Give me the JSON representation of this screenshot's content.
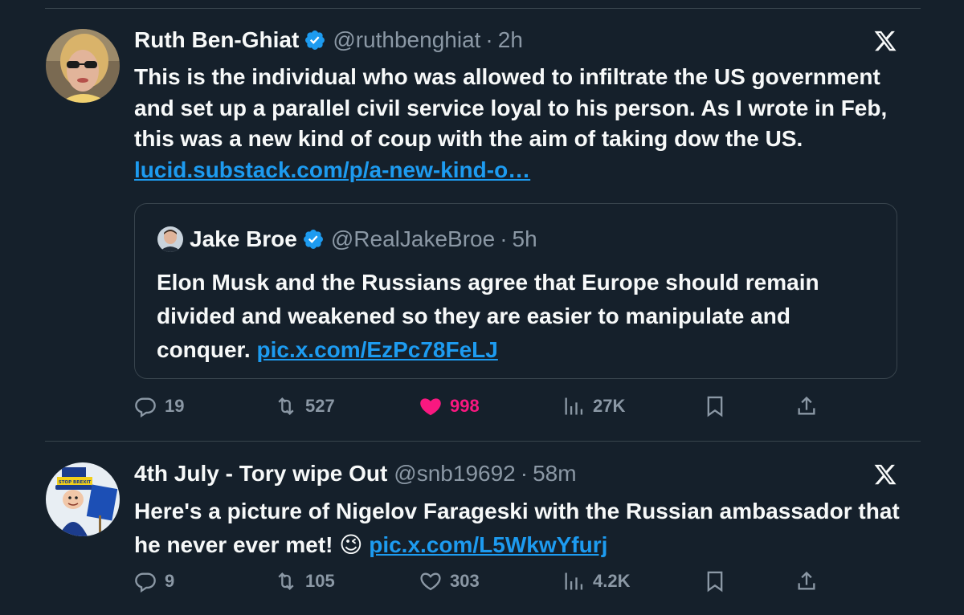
{
  "tweets": [
    {
      "name": "Ruth Ben-Ghiat",
      "handle": "@ruthbenghiat",
      "separator": "·",
      "time": "2h",
      "verified": true,
      "text": "This is the individual who was allowed to infiltrate the US government and set up a parallel civil service loyal to his person. As I wrote in Feb, this was a new kind of coup with the aim of taking dow  the US.",
      "link": "lucid.substack.com/p/a-new-kind-o…",
      "quote": {
        "name": "Jake Broe",
        "handle": "@RealJakeBroe",
        "separator": "·",
        "time": "5h",
        "verified": true,
        "text": "Elon Musk and the Russians agree that Europe should remain divided and weakened so they are easier to manipulate and conquer.",
        "link": "pic.x.com/EzPc78FeLJ"
      },
      "actions": {
        "replies": "19",
        "reposts": "527",
        "likes": "998",
        "liked": true,
        "views": "27K"
      }
    },
    {
      "name": "4th July - Tory wipe Out",
      "handle": "@snb19692",
      "separator": "·",
      "time": "58m",
      "verified": false,
      "text": "Here's a picture of Nigelov Farageski with the Russian ambassador that he never ever met! 😉",
      "link": "pic.x.com/L5WkwYfurj",
      "actions": {
        "replies": "9",
        "reposts": "105",
        "likes": "303",
        "liked": false,
        "views": "4.2K"
      },
      "avatar_badge": "STOP BREXIT"
    }
  ],
  "colors": {
    "background": "#15202b",
    "text": "#f7f9f9",
    "muted": "#8b98a5",
    "link": "#1d9bf0",
    "like": "#f91880",
    "border": "#38444d"
  },
  "icons": [
    "reply-icon",
    "repost-icon",
    "like-icon",
    "views-icon",
    "bookmark-icon",
    "share-icon",
    "x-logo-icon",
    "verified-icon"
  ]
}
